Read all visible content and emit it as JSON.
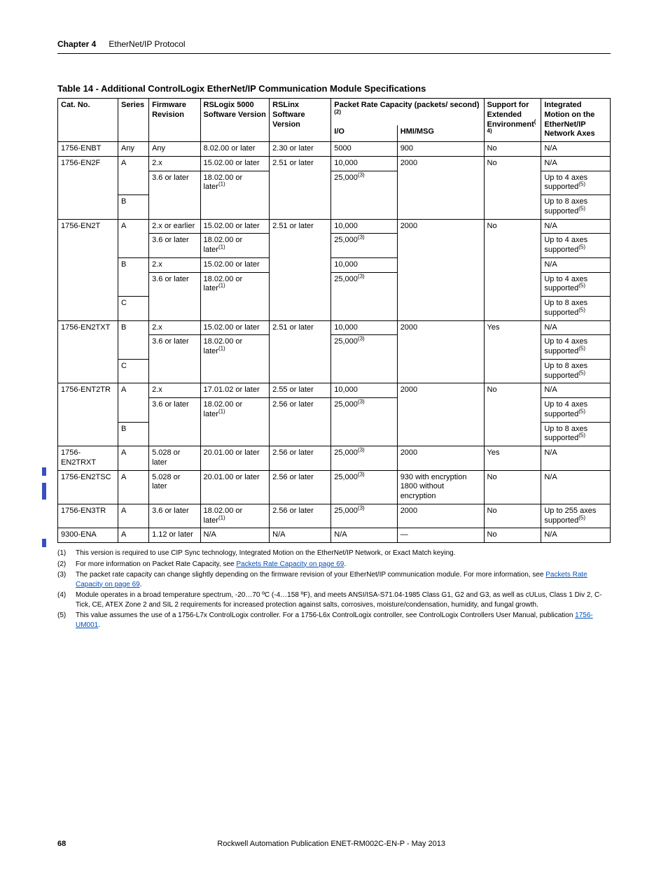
{
  "header": {
    "chapter": "Chapter 4",
    "section": "EtherNet/IP Protocol"
  },
  "table": {
    "title": "Table 14 - Additional ControlLogix EtherNet/IP Communication Module Specifications",
    "cols": {
      "cat": "Cat. No.",
      "series": "Series",
      "fw": "Firmware Revision",
      "rs5k": "RSLogix 5000 Software Version",
      "rslinx": "RSLinx Software Version",
      "packet": "Packet Rate Capacity (packets/ second)",
      "packet_sup": "(2)",
      "io": "I/O",
      "hmi": "HMI/MSG",
      "ext": "Support for Extended Environment",
      "ext_sup": "(4)",
      "motion": "Integrated Motion on the EtherNet/IP Network Axes"
    },
    "rows": [
      {
        "cat": "1756-ENBT",
        "ser": "Any",
        "fw": "Any",
        "rs5k": "8.02.00 or later",
        "rsl": "2.30 or later",
        "io": "5000",
        "hmi": "900",
        "ext": "No",
        "mot": "N/A"
      },
      {
        "cat": "1756-EN2F",
        "ser": "A",
        "fw": "2.x",
        "rs5k": "15.02.00 or later",
        "rsl": "2.51 or later",
        "io": "10,000",
        "hmi": "2000",
        "ext": "No",
        "mot": "N/A",
        "cat_span": 3,
        "rsl_span": 3,
        "hmi_span": 3,
        "ext_span": 3
      },
      {
        "fw": "3.6 or later",
        "rs5k": "18.02.00 or later",
        "rs5k_sup": "(1)",
        "io": "25,000",
        "io_sup": "(3)",
        "mot": "Up to 4 axes supported",
        "mot_sup": "(5)",
        "ser_span": false,
        "io_span": 2
      },
      {
        "ser": "B",
        "mot": "Up to 8 axes supported",
        "mot_sup": "(5)",
        "fw_span": false,
        "rs5k_span": false
      },
      {
        "cat": "1756-EN2T",
        "ser": "A",
        "fw": "2.x or earlier",
        "rs5k": "15.02.00 or later",
        "rsl": "2.51 or later",
        "io": "10,000",
        "hmi": "2000",
        "ext": "No",
        "mot": "N/A",
        "cat_span": 5,
        "rsl_span": 5,
        "hmi_span": 5,
        "ext_span": 5
      },
      {
        "fw": "3.6 or later",
        "rs5k": "18.02.00 or later",
        "rs5k_sup": "(1)",
        "io": "25,000",
        "io_sup": "(3)",
        "mot": "Up to 4 axes supported",
        "mot_sup": "(5)",
        "ser_span": false
      },
      {
        "ser": "B",
        "fw": "2.x",
        "rs5k": "15.02.00 or later",
        "io": "10,000",
        "mot": "N/A"
      },
      {
        "fw": "3.6 or later",
        "rs5k": "18.02.00 or later",
        "rs5k_sup": "(1)",
        "io": "25,000",
        "io_sup": "(3)",
        "mot": "Up to 4 axes supported",
        "mot_sup": "(5)",
        "ser_span": false,
        "io_span": 2
      },
      {
        "ser": "C",
        "mot": "Up to 8 axes supported",
        "mot_sup": "(5)",
        "fw_span": false,
        "rs5k_span": false
      },
      {
        "cat": "1756-EN2TXT",
        "ser": "B",
        "fw": "2.x",
        "rs5k": "15.02.00 or later",
        "rsl": "2.51 or later",
        "io": "10,000",
        "hmi": "2000",
        "ext": "Yes",
        "mot": "N/A",
        "cat_span": 3,
        "rsl_span": 3,
        "hmi_span": 3,
        "ext_span": 3
      },
      {
        "fw": "3.6 or later",
        "rs5k": "18.02.00 or later",
        "rs5k_sup": "(1)",
        "io": "25,000",
        "io_sup": "(3)",
        "mot": "Up to 4 axes supported",
        "mot_sup": "(5)",
        "ser_span": false,
        "io_span": 2
      },
      {
        "ser": "C",
        "mot": "Up to 8 axes supported",
        "mot_sup": "(5)",
        "fw_span": false,
        "rs5k_span": false
      },
      {
        "cat": "1756-ENT2TR",
        "ser": "A",
        "fw": "2.x",
        "rs5k": "17.01.02 or later",
        "rsl": "2.55 or later",
        "io": "10,000",
        "hmi": "2000",
        "ext": "No",
        "mot": "N/A",
        "cat_span": 3,
        "hmi_span": 3,
        "ext_span": 3
      },
      {
        "fw": "3.6 or later",
        "rs5k": "18.02.00 or later",
        "rs5k_sup": "(1)",
        "rsl": "2.56 or later",
        "io": "25,000",
        "io_sup": "(3)",
        "mot": "Up to 4 axes supported",
        "mot_sup": "(5)",
        "ser_span": false,
        "rsl_span": 2,
        "io_span": 2
      },
      {
        "ser": "B",
        "mot": "Up to 8 axes supported",
        "mot_sup": "(5)",
        "fw_span": false,
        "rs5k_span": false
      },
      {
        "cat": "1756-EN2TRXT",
        "ser": "A",
        "fw": "5.028 or later",
        "rs5k": "20.01.00 or later",
        "rsl": "2.56 or later",
        "io": "25,000",
        "io_sup": "(3)",
        "hmi": "2000",
        "ext": "Yes",
        "mot": "N/A"
      },
      {
        "cat": "1756-EN2TSC",
        "ser": "A",
        "fw": "5.028 or later",
        "rs5k": "20.01.00 or later",
        "rsl": "2.56 or later",
        "io": "25,000",
        "io_sup": "(3)",
        "hmi": "930 with encryption 1800 without encryption",
        "ext": "No",
        "mot": "N/A"
      },
      {
        "cat": "1756-EN3TR",
        "ser": "A",
        "fw": "3.6 or later",
        "rs5k": "18.02.00 or later",
        "rs5k_sup": "(1)",
        "rsl": "2.56 or later",
        "io": "25,000",
        "io_sup": "(3)",
        "hmi": "2000",
        "ext": "No",
        "mot": "Up to 255 axes supported",
        "mot_sup": "(5)"
      },
      {
        "cat": "9300-ENA",
        "ser": "A",
        "fw": "1.12 or later",
        "rs5k": "N/A",
        "rsl": "N/A",
        "io": "N/A",
        "hmi": "—",
        "ext": "No",
        "mot": "N/A"
      }
    ]
  },
  "footnotes": {
    "f1": {
      "num": "(1)",
      "text": "This version is required to use CIP Sync technology, Integrated Motion on the EtherNet/IP Network, or Exact Match keying."
    },
    "f2": {
      "num": "(2)",
      "pre": "For more information on Packet Rate Capacity, see ",
      "link": "Packets Rate Capacity on page 69",
      "post": "."
    },
    "f3": {
      "num": "(3)",
      "pre": "The packet rate capacity can change slightly depending on the firmware revision of your EtherNet/IP communication module. For more information, see ",
      "link": "Packets Rate Capacity on page 69",
      "post": "."
    },
    "f4": {
      "num": "(4)",
      "text": "Module operates in a broad temperature spectrum, -20…70 ºC (-4…158 ºF), and meets ANSI/ISA-S71.04-1985 Class G1, G2 and G3, as well as cULus, Class 1 Div 2, C-Tick, CE, ATEX Zone 2 and SIL 2 requirements for increased protection against salts, corrosives, moisture/condensation, humidity, and fungal growth."
    },
    "f5": {
      "num": "(5)",
      "pre": "This value assumes the use of a 1756-L7x ControlLogix controller. For a 1756-L6x ControlLogix controller, see ControlLogix Controllers User Manual, publication ",
      "link": "1756-UM001",
      "post": "."
    }
  },
  "footer": {
    "page": "68",
    "pub": "Rockwell Automation Publication ENET-RM002C-EN-P - May 2013"
  }
}
